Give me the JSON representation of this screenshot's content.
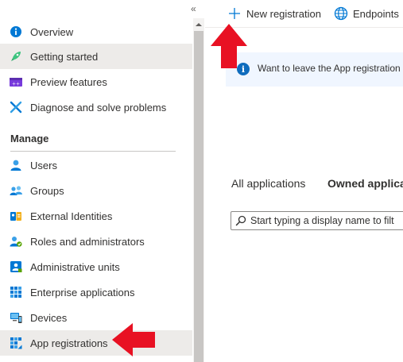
{
  "sidebar": {
    "collapse_glyph": "«",
    "items": [
      {
        "label": "Overview",
        "icon": "info-icon"
      },
      {
        "label": "Getting started",
        "icon": "rocket-icon"
      },
      {
        "label": "Preview features",
        "icon": "preview-features-icon"
      },
      {
        "label": "Diagnose and solve problems",
        "icon": "wrench-icon"
      }
    ],
    "manage_heading": "Manage",
    "manage_items": [
      {
        "label": "Users",
        "icon": "user-icon"
      },
      {
        "label": "Groups",
        "icon": "groups-icon"
      },
      {
        "label": "External Identities",
        "icon": "external-identities-icon"
      },
      {
        "label": "Roles and administrators",
        "icon": "roles-icon"
      },
      {
        "label": "Administrative units",
        "icon": "admin-units-icon"
      },
      {
        "label": "Enterprise applications",
        "icon": "enterprise-apps-icon"
      },
      {
        "label": "Devices",
        "icon": "devices-icon"
      },
      {
        "label": "App registrations",
        "icon": "app-registrations-icon"
      }
    ]
  },
  "toolbar": {
    "new_registration": "New registration",
    "endpoints": "Endpoints"
  },
  "banner": {
    "icon_glyph": "i",
    "text": "Want to leave the App registration"
  },
  "tabs": {
    "all": "All applications",
    "owned": "Owned applica"
  },
  "search": {
    "placeholder": "Start typing a display name to filt"
  },
  "colors": {
    "accent": "#0078d4",
    "annotation_arrow": "#e81123",
    "active_row": "#edebe9"
  }
}
